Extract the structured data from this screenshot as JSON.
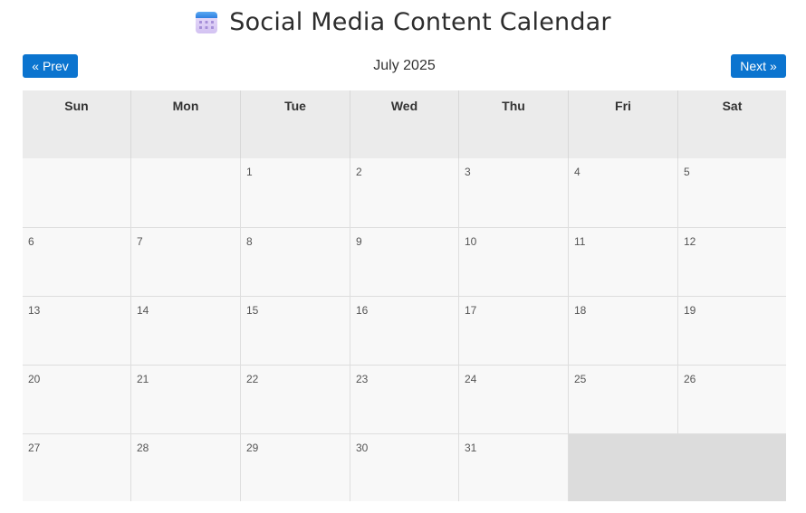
{
  "header": {
    "title": "Social Media Content Calendar",
    "icon": "calendar-icon"
  },
  "nav": {
    "prev_label": "« Prev",
    "next_label": "Next »",
    "month_label": "July 2025"
  },
  "colors": {
    "button": "#0b74cf",
    "header_bg": "#ebebeb",
    "cell_bg": "#f8f8f8",
    "empty_bg": "#dcdcdc"
  },
  "calendar": {
    "weekdays": [
      "Sun",
      "Mon",
      "Tue",
      "Wed",
      "Thu",
      "Fri",
      "Sat"
    ],
    "weeks": [
      [
        "",
        "",
        "1",
        "2",
        "3",
        "4",
        "5"
      ],
      [
        "6",
        "7",
        "8",
        "9",
        "10",
        "11",
        "12"
      ],
      [
        "13",
        "14",
        "15",
        "16",
        "17",
        "18",
        "19"
      ],
      [
        "20",
        "21",
        "22",
        "23",
        "24",
        "25",
        "26"
      ],
      [
        "27",
        "28",
        "29",
        "30",
        "31"
      ]
    ]
  }
}
